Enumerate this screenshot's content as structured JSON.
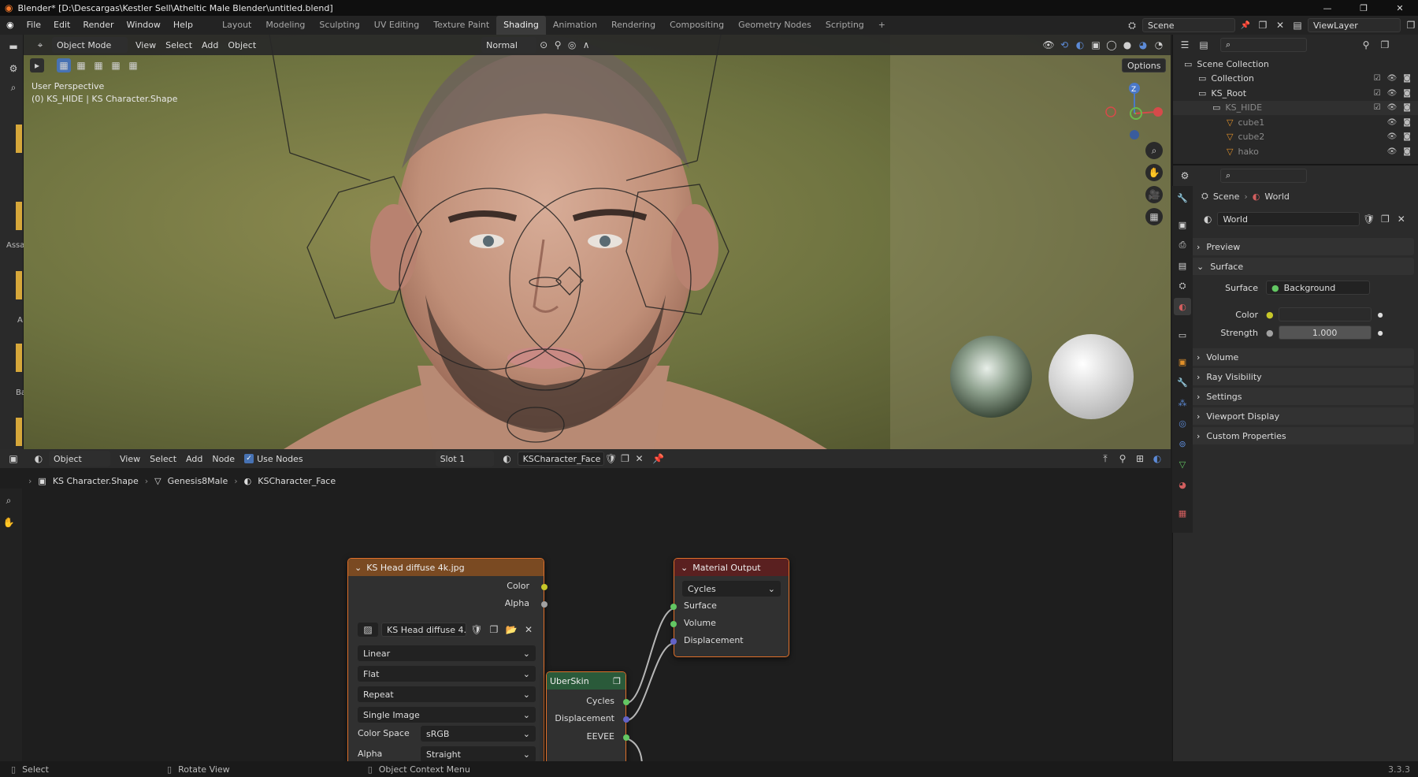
{
  "window": {
    "title": "Blender* [D:\\Descargas\\Kestler Sell\\Atheltic Male Blender\\untitled.blend]"
  },
  "menu": {
    "items": [
      "File",
      "Edit",
      "Render",
      "Window",
      "Help"
    ],
    "workspaces": [
      "Layout",
      "Modeling",
      "Sculpting",
      "UV Editing",
      "Texture Paint",
      "Shading",
      "Animation",
      "Rendering",
      "Compositing",
      "Geometry Nodes",
      "Scripting"
    ],
    "active_workspace": "Shading",
    "scene": "Scene",
    "view_layer": "ViewLayer"
  },
  "viewport": {
    "mode": "Object Mode",
    "menus": [
      "View",
      "Select",
      "Add",
      "Object"
    ],
    "orientation": "Normal",
    "options_label": "Options",
    "overlay_line1": "User Perspective",
    "overlay_line2": "(0) KS_HIDE | KS Character.Shape",
    "gizmo_axis_z": "Z",
    "left_labels": [
      "Assa",
      "A",
      "Ba"
    ]
  },
  "outliner": {
    "rows": [
      {
        "label": "Scene Collection",
        "indent": 0
      },
      {
        "label": "Collection",
        "indent": 1
      },
      {
        "label": "KS_Root",
        "indent": 1
      },
      {
        "label": "KS_HIDE",
        "indent": 2
      },
      {
        "label": "cube1",
        "indent": 3
      },
      {
        "label": "cube2",
        "indent": 3
      },
      {
        "label": "hako",
        "indent": 3
      }
    ]
  },
  "properties": {
    "breadcrumb_scene": "Scene",
    "breadcrumb_world": "World",
    "world_name": "World",
    "panels": {
      "preview": "Preview",
      "surface": "Surface",
      "volume": "Volume",
      "ray_visibility": "Ray Visibility",
      "settings": "Settings",
      "viewport_display": "Viewport Display",
      "custom_properties": "Custom Properties"
    },
    "surface_label": "Surface",
    "surface_value": "Background",
    "color_label": "Color",
    "strength_label": "Strength",
    "strength_value": "1.000"
  },
  "node_editor": {
    "mode": "Object",
    "menus": [
      "View",
      "Select",
      "Add",
      "Node"
    ],
    "use_nodes_label": "Use Nodes",
    "slot": "Slot 1",
    "material": "KSCharacter_Face",
    "breadcrumb": [
      "KS Character.Shape",
      "Genesis8Male",
      "KSCharacter_Face"
    ]
  },
  "image_node": {
    "title": "KS Head diffuse 4k.jpg",
    "out_color": "Color",
    "out_alpha": "Alpha",
    "image_field": "KS Head diffuse 4...",
    "interpolation": "Linear",
    "projection": "Flat",
    "extension": "Repeat",
    "source": "Single Image",
    "color_space_label": "Color Space",
    "color_space_value": "sRGB",
    "alpha_label": "Alpha",
    "alpha_value": "Straight"
  },
  "output_node": {
    "title": "Material Output",
    "target": "Cycles",
    "in_surface": "Surface",
    "in_volume": "Volume",
    "in_displacement": "Displacement"
  },
  "uberskin_node": {
    "title": "UberSkin",
    "out_cycles": "Cycles",
    "out_displacement": "Displacement",
    "out_eevee": "EEVEE"
  },
  "statusbar": {
    "select": "Select",
    "rotate_view": "Rotate View",
    "context_menu": "Object Context Menu",
    "version": "3.3.3"
  },
  "colors": {
    "accent_orange": "#e0702a",
    "socket_yellow": "#c7c729",
    "socket_gray": "#a1a1a1",
    "socket_green": "#63c763",
    "socket_blue": "#6363c7",
    "active_blue": "#4772b3"
  }
}
